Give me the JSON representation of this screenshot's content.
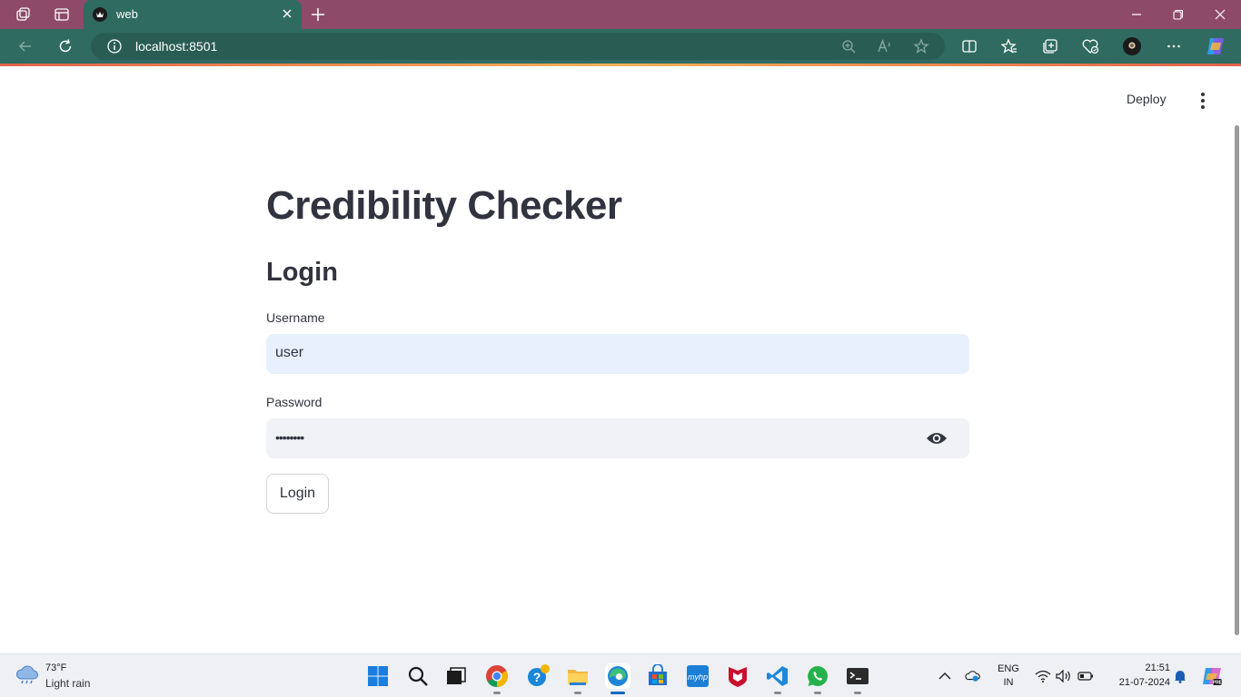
{
  "browser": {
    "tab_title": "web",
    "url": "localhost:8501",
    "icons": [
      "workspaces-icon",
      "tab-actions-icon",
      "close-tab-icon",
      "new-tab-icon",
      "minimize-icon",
      "restore-icon",
      "close-window-icon",
      "back-icon",
      "refresh-icon",
      "site-info-icon",
      "zoom-icon",
      "read-aloud-icon",
      "favorite-icon",
      "split-screen-icon",
      "favorites-icon",
      "collections-icon",
      "browser-essentials-icon",
      "profile-avatar-icon",
      "more-icon",
      "copilot-icon"
    ],
    "colors": {
      "tabstrip": "#8e4a69",
      "toolbar": "#2f6b60"
    }
  },
  "app": {
    "deploy_label": "Deploy",
    "title": "Credibility Checker",
    "login_heading": "Login",
    "username_label": "Username",
    "username_value": "user",
    "password_label": "Password",
    "password_value": "••••••••",
    "login_button": "Login",
    "colors": {
      "text": "#31333f",
      "username_bg": "#e8f0fe",
      "password_bg": "#f0f2f6"
    }
  },
  "taskbar": {
    "weather_temp": "73°F",
    "weather_desc": "Light rain",
    "apps": [
      "start-icon",
      "search-icon",
      "task-view-icon",
      "chrome-icon",
      "help-icon",
      "file-explorer-icon",
      "edge-icon",
      "store-icon",
      "hp-icon",
      "mcafee-icon",
      "vscode-icon",
      "whatsapp-icon",
      "terminal-icon"
    ],
    "lang_top": "ENG",
    "lang_bottom": "IN",
    "time": "21:51",
    "date": "21-07-2024"
  }
}
